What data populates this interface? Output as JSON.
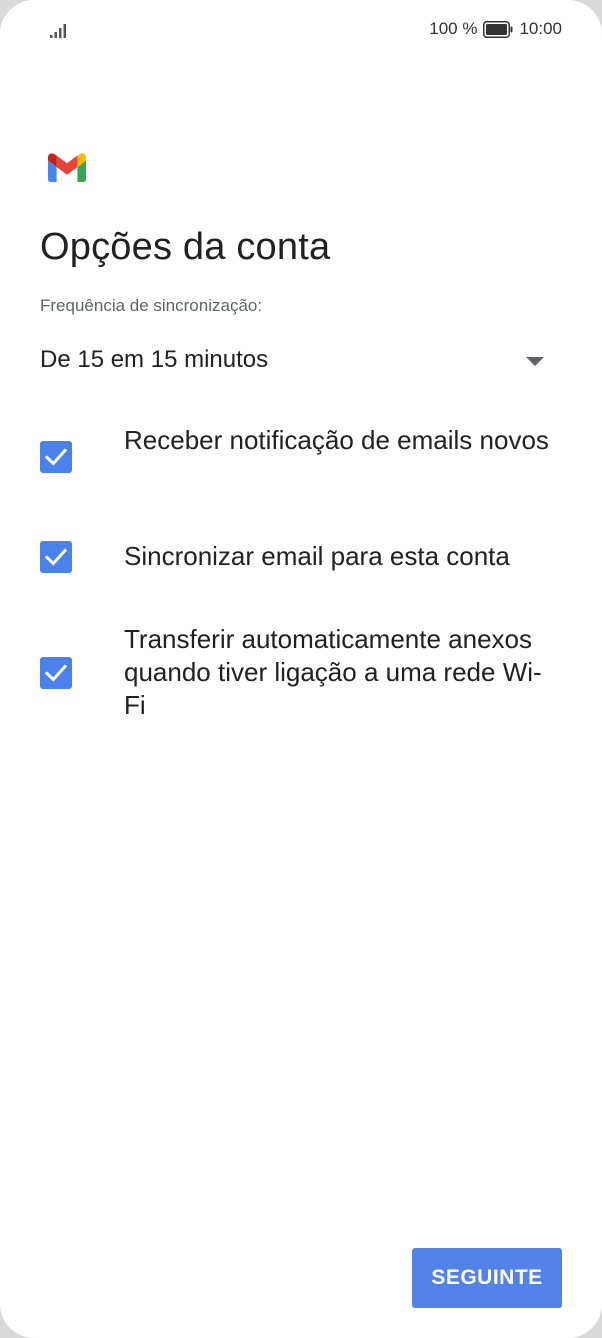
{
  "status_bar": {
    "battery_percent": "100 %",
    "time": "10:00",
    "signal_icon": "signal-icon",
    "battery_icon": "battery-icon"
  },
  "logo": "gmail-logo-icon",
  "title": "Opções da conta",
  "sync": {
    "label": "Frequência de sincronização:",
    "selected": "De 15 em 15 minutos"
  },
  "options": [
    {
      "label": "Receber notificação de emails novos",
      "checked": true
    },
    {
      "label": "Sincronizar email para esta conta",
      "checked": true
    },
    {
      "label": "Transferir automaticamente anexos quando tiver ligação a uma rede Wi-Fi",
      "checked": true
    }
  ],
  "next_button": {
    "label": "SEGUINTE"
  },
  "colors": {
    "accent": "#4a81ea",
    "button": "#5383e8"
  }
}
